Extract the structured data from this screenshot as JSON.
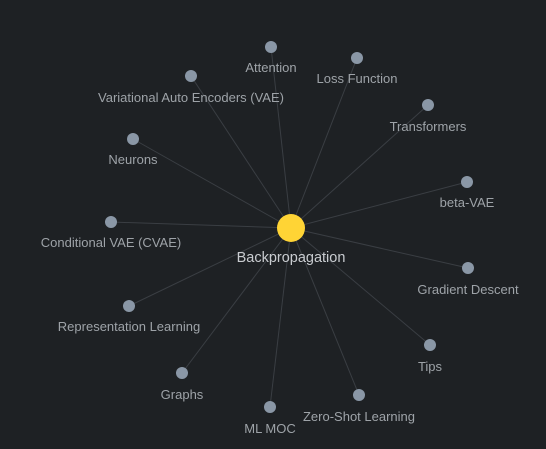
{
  "graph": {
    "center": {
      "name": "node-backpropagation",
      "label": "Backpropagation",
      "color": "#ffd435"
    },
    "node_color": "#8a97a6",
    "edge_color": "#3a3e43",
    "background": "#1e2124",
    "nodes": [
      {
        "name": "node-attention",
        "label": "Attention"
      },
      {
        "name": "node-loss-function",
        "label": "Loss Function"
      },
      {
        "name": "node-variational-auto-encoders",
        "label": "Variational Auto Encoders (VAE)"
      },
      {
        "name": "node-transformers",
        "label": "Transformers"
      },
      {
        "name": "node-neurons",
        "label": "Neurons"
      },
      {
        "name": "node-beta-vae",
        "label": "beta-VAE"
      },
      {
        "name": "node-conditional-vae",
        "label": "Conditional VAE (CVAE)"
      },
      {
        "name": "node-gradient-descent",
        "label": "Gradient Descent"
      },
      {
        "name": "node-representation-learning",
        "label": "Representation Learning"
      },
      {
        "name": "node-tips",
        "label": "Tips"
      },
      {
        "name": "node-graphs",
        "label": "Graphs"
      },
      {
        "name": "node-zero-shot-learning",
        "label": "Zero-Shot Learning"
      },
      {
        "name": "node-ml-moc",
        "label": "ML MOC"
      }
    ]
  }
}
